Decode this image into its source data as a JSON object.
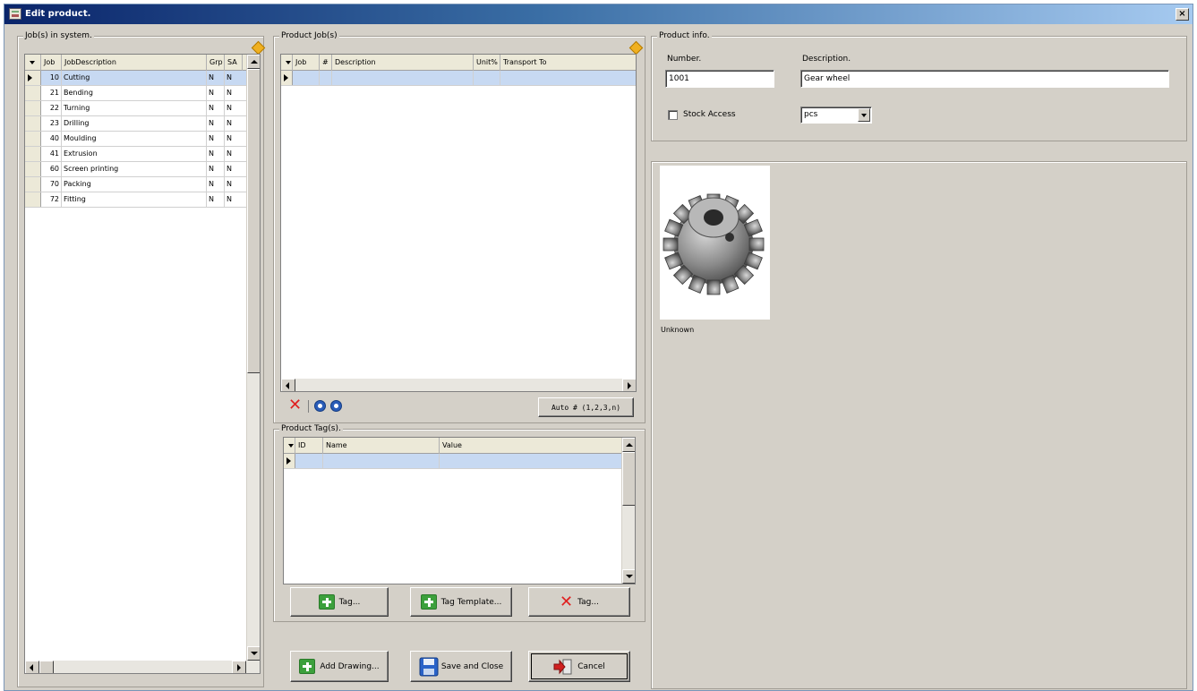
{
  "window": {
    "title": "Edit product.",
    "close_glyph": "×"
  },
  "jobs_system": {
    "label": "Job(s) in system.",
    "columns": [
      "Job",
      "JobDescription",
      "Grp",
      "SA"
    ],
    "rows": [
      {
        "job": "10",
        "desc": "Cutting",
        "grp": "N",
        "sa": "N"
      },
      {
        "job": "21",
        "desc": "Bending",
        "grp": "N",
        "sa": "N"
      },
      {
        "job": "22",
        "desc": "Turning",
        "grp": "N",
        "sa": "N"
      },
      {
        "job": "23",
        "desc": "Drilling",
        "grp": "N",
        "sa": "N"
      },
      {
        "job": "40",
        "desc": "Moulding",
        "grp": "N",
        "sa": "N"
      },
      {
        "job": "41",
        "desc": "Extrusion",
        "grp": "N",
        "sa": "N"
      },
      {
        "job": "60",
        "desc": "Screen printing",
        "grp": "N",
        "sa": "N"
      },
      {
        "job": "70",
        "desc": "Packing",
        "grp": "N",
        "sa": "N"
      },
      {
        "job": "72",
        "desc": "Fitting",
        "grp": "N",
        "sa": "N"
      }
    ]
  },
  "product_jobs": {
    "label": "Product Job(s)",
    "columns": [
      "Job",
      "#",
      "Description",
      "Unit%",
      "Transport To"
    ],
    "auto_button": "Auto # (1,2,3,n)"
  },
  "product_tags": {
    "label": "Product Tag(s).",
    "columns": [
      "ID",
      "Name",
      "Value"
    ],
    "buttons": {
      "add_tag": "Tag...",
      "tag_template": "Tag Template...",
      "delete_tag": "Tag..."
    }
  },
  "bottom_buttons": {
    "add_drawing": "Add Drawing...",
    "save_close": "Save and Close",
    "cancel": "Cancel"
  },
  "product_info": {
    "label": "Product info.",
    "number_label": "Number.",
    "number_value": "1001",
    "description_label": "Description.",
    "description_value": "Gear wheel",
    "stock_access_label": "Stock Access",
    "stock_access_checked": false,
    "unit_value": "pcs"
  },
  "drawings": [
    {
      "caption": "Unknown",
      "icon": "gear-wheel-image"
    }
  ],
  "icons": {
    "pin": "pin-icon",
    "delete": "red-x-icon",
    "move_up": "move-up-icon",
    "move_down": "move-down-icon",
    "add": "green-plus-icon",
    "save": "floppy-disk-icon",
    "cancel": "exit-door-icon"
  },
  "colors": {
    "title_gradient_start": "#0a246a",
    "selected_row": "#c7d9f2",
    "window_bg": "#d4d0c8"
  }
}
